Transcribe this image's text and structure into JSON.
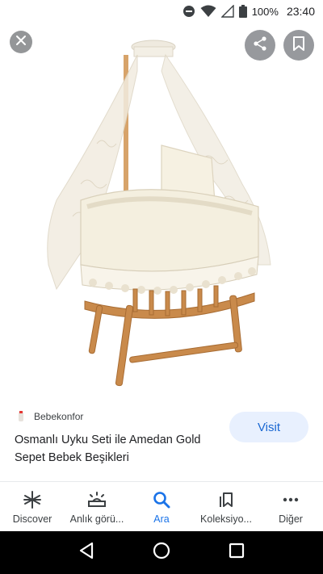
{
  "status_bar": {
    "battery_percent": "100%",
    "time": "23:40",
    "icons": [
      "do-not-disturb-icon",
      "wifi-icon",
      "cell-signal-icon",
      "battery-icon"
    ]
  },
  "viewer": {
    "image_subject": "baby-bassinet-with-lace-canopy",
    "controls": {
      "close_icon": "close-icon",
      "share_icon": "share-icon",
      "save_icon": "bookmark-icon"
    }
  },
  "result": {
    "source": "Bebekonfor",
    "title": "Osmanlı Uyku Seti ile Amedan Gold Sepet Bebek Beşikleri",
    "visit_label": "Visit"
  },
  "app_nav": {
    "items": [
      {
        "label": "Discover",
        "icon": "asterisk-icon",
        "active": false
      },
      {
        "label": "Anlık görü...",
        "icon": "snapshot-icon",
        "active": false
      },
      {
        "label": "Ara",
        "icon": "search-icon",
        "active": true
      },
      {
        "label": "Koleksiyo...",
        "icon": "collections-icon",
        "active": false
      },
      {
        "label": "Diğer",
        "icon": "more-icon",
        "active": false
      }
    ]
  },
  "colors": {
    "accent": "#1a73e8",
    "visit_bg": "#e8f0fe",
    "visit_text": "#1967d2",
    "system_nav_bg": "#000000"
  }
}
